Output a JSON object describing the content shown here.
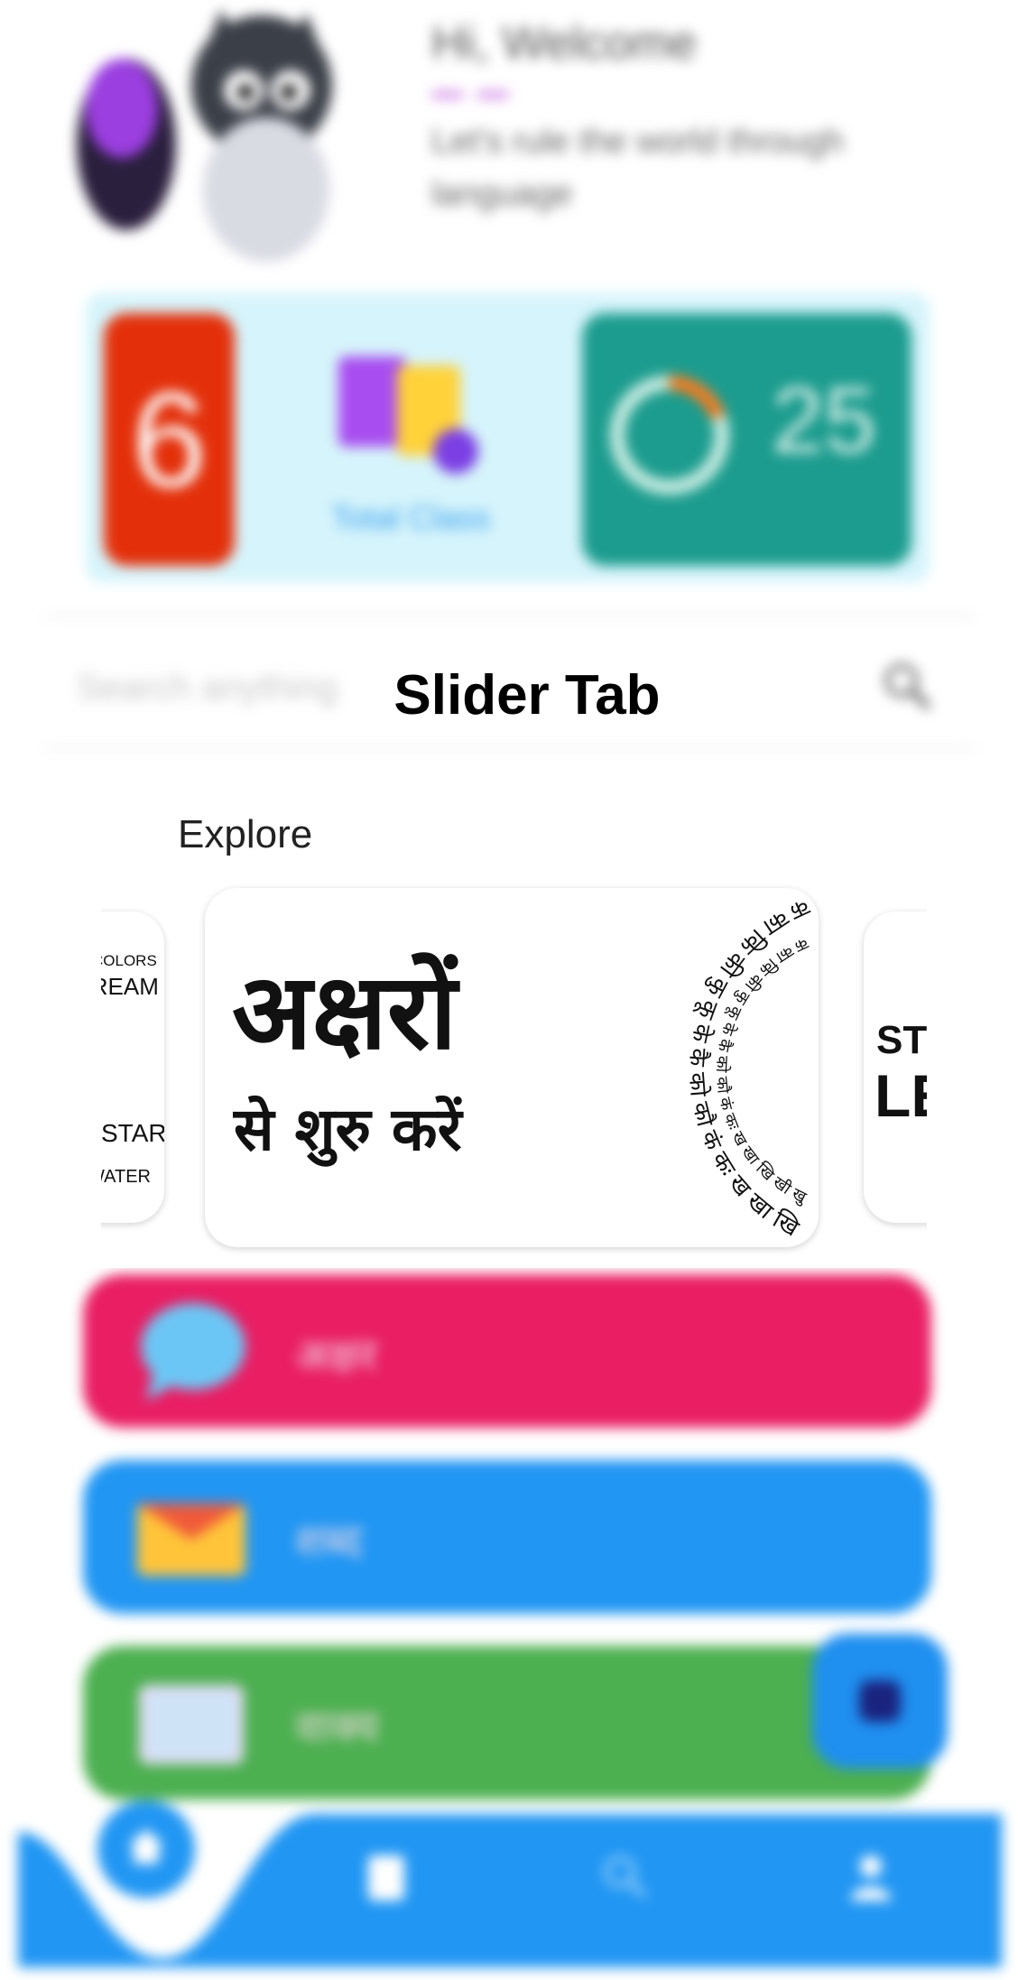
{
  "header": {
    "greeting": "Hi, Welcome",
    "subtitle": "Let's rule the world through language"
  },
  "stats": {
    "count_value": "6",
    "total_label": "Total Class",
    "ring_value": "25",
    "colors": {
      "count_card": "#e3300b",
      "ring_card": "#1c9c8e",
      "band": "#d6f4fb"
    }
  },
  "search": {
    "placeholder": "Search anything"
  },
  "overlay": {
    "label": "Slider Tab"
  },
  "explore": {
    "title": "Explore",
    "slides": [
      {
        "id": "left",
        "lines": [
          "COLORS",
          "DREAM",
          "STAR",
          "WATER"
        ]
      },
      {
        "id": "main",
        "line1": "अक्षरों",
        "line2": "से शुरु करें",
        "ring_text": "क का कि की कु कू के कै को कौ कं कः ख खा खि खी खु खू खे खै खो खौ खं खः ग गा गि गी गु गू गे गै गो गौ"
      },
      {
        "id": "right",
        "line1": "ST",
        "line2": "LE"
      }
    ]
  },
  "rows": [
    {
      "label": "अक्षर",
      "icon": "chat-bubble-icon",
      "color": "#e91e63"
    },
    {
      "label": "शब्द",
      "icon": "envelope-icon",
      "color": "#2196f3"
    },
    {
      "label": "वाक्य",
      "icon": "book-icon",
      "color": "#4caf50"
    }
  ],
  "nav": {
    "items": [
      "home-icon",
      "document-icon",
      "search-icon",
      "profile-icon"
    ],
    "color": "#2196f3"
  }
}
